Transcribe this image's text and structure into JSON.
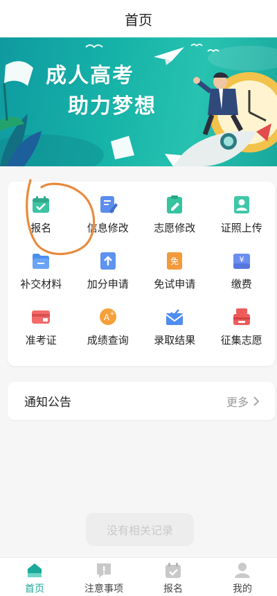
{
  "header": {
    "title": "首页"
  },
  "banner": {
    "line1": "成人高考",
    "line2": "助力梦想"
  },
  "menu": {
    "items": [
      {
        "label": "报名",
        "icon": "calendar-check-icon",
        "color": "#3dc3a3"
      },
      {
        "label": "信息修改",
        "icon": "edit-document-icon",
        "color": "#5b8dee"
      },
      {
        "label": "志愿修改",
        "icon": "clipboard-edit-icon",
        "color": "#36c4a0"
      },
      {
        "label": "证照上传",
        "icon": "id-photo-icon",
        "color": "#3fc7a8"
      },
      {
        "label": "补交材料",
        "icon": "folder-icon",
        "color": "#4d8ff0"
      },
      {
        "label": "加分申请",
        "icon": "upload-arrow-icon",
        "color": "#5e93f0"
      },
      {
        "label": "免试申请",
        "icon": "exempt-document-icon",
        "color": "#f39a3d"
      },
      {
        "label": "缴费",
        "icon": "yuan-payment-icon",
        "color": "#6d8ef0"
      },
      {
        "label": "准考证",
        "icon": "admission-card-icon",
        "color": "#f26a6a"
      },
      {
        "label": "成绩查询",
        "icon": "grade-a-plus-icon",
        "color": "#f5a03a"
      },
      {
        "label": "录取结果",
        "icon": "envelope-icon",
        "color": "#4f8df0"
      },
      {
        "label": "征集志愿",
        "icon": "mailbox-icon",
        "color": "#ee5b5b"
      }
    ]
  },
  "notice": {
    "title": "通知公告",
    "more": "更多"
  },
  "empty_toast": "没有相关记录",
  "tabbar": {
    "items": [
      {
        "label": "首页",
        "icon": "home-icon",
        "active": true
      },
      {
        "label": "注意事项",
        "icon": "notice-icon",
        "active": false
      },
      {
        "label": "报名",
        "icon": "register-calendar-icon",
        "active": false
      },
      {
        "label": "我的",
        "icon": "user-icon",
        "active": false
      }
    ]
  },
  "colors": {
    "accent": "#1aa99a",
    "annotation_circle": "#e88a3c"
  }
}
